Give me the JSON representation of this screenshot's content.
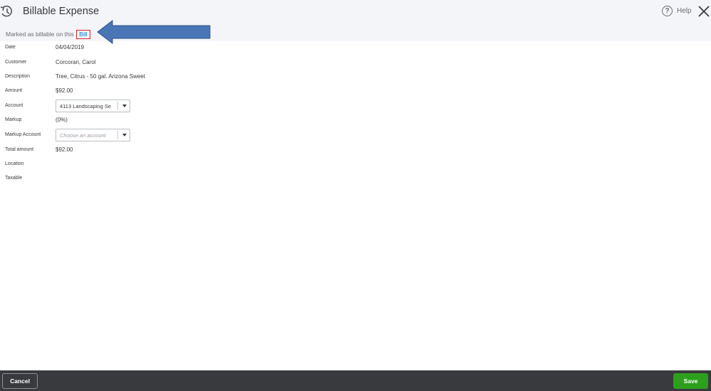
{
  "header": {
    "title": "Billable Expense",
    "help_label": "Help",
    "help_glyph": "?"
  },
  "billable_note": {
    "text": "Marked as billable on this",
    "link": "Bill",
    "highlight_color": "#e0212a",
    "arrow_color": "#4a76b8"
  },
  "fields": {
    "date": {
      "label": "Date",
      "value": "04/04/2019"
    },
    "customer": {
      "label": "Customer",
      "value": "Corcoran, Carol"
    },
    "description": {
      "label": "Description",
      "value": "Tree, Citrus - 50 gal. Arizona Sweet"
    },
    "amount": {
      "label": "Amount",
      "value": "$92.00"
    },
    "account": {
      "label": "Account",
      "value": "4113 Landscaping Se"
    },
    "markup": {
      "label": "Markup",
      "value": "(0%)"
    },
    "markup_account": {
      "label": "Markup Account",
      "placeholder": "Choose an account"
    },
    "total_amount": {
      "label": "Total amount",
      "value": "$92.00"
    },
    "location": {
      "label": "Location"
    },
    "taxable": {
      "label": "Taxable"
    }
  },
  "footer": {
    "cancel_label": "Cancel",
    "save_label": "Save",
    "save_color": "#2ca01c"
  },
  "icons": [
    "history-icon",
    "help-icon",
    "close-icon",
    "chevron-down-icon"
  ]
}
